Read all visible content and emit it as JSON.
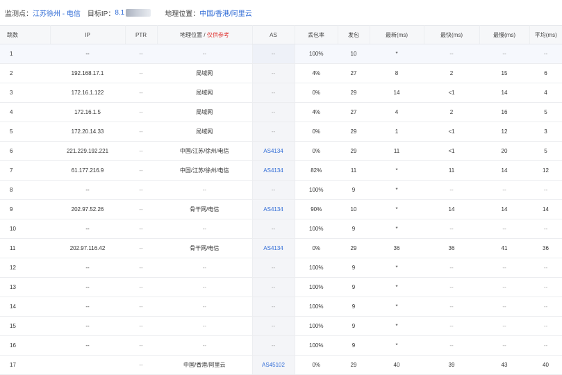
{
  "header": {
    "monitor_label": "监测点：",
    "monitor_value": "江苏徐州 - 电信",
    "target_label": "目标IP：",
    "target_value": "8.1",
    "geo_label": "地理位置：",
    "geo_value": "中国/香港/阿里云"
  },
  "columns": {
    "hop": "跳数",
    "ip": "IP",
    "ptr": "PTR",
    "geo": "地理位置 / ",
    "geo_note": "仅供参考",
    "as": "AS",
    "loss": "丢包率",
    "sent": "发包",
    "last": "最新(ms)",
    "best": "最快(ms)",
    "worst": "最慢(ms)",
    "avg": "平均(ms)"
  },
  "colors": {
    "link": "#2f6bd6",
    "note_red": "#e0312e",
    "header_bg": "#f6f7f9",
    "highlight_row": "#f6f8fd"
  },
  "rows": [
    {
      "hop": "1",
      "ip": "--",
      "ptr": "--",
      "geo": "--",
      "as": "--",
      "loss": "100%",
      "sent": "10",
      "last": "*",
      "best": "--",
      "worst": "--",
      "avg": "--"
    },
    {
      "hop": "2",
      "ip": "192.168.17.1",
      "ptr": "--",
      "geo": "局域网",
      "as": "--",
      "loss": "4%",
      "sent": "27",
      "last": "8",
      "best": "2",
      "worst": "15",
      "avg": "6"
    },
    {
      "hop": "3",
      "ip": "172.16.1.122",
      "ptr": "--",
      "geo": "局域网",
      "as": "--",
      "loss": "0%",
      "sent": "29",
      "last": "14",
      "best": "<1",
      "worst": "14",
      "avg": "4"
    },
    {
      "hop": "4",
      "ip": "172.16.1.5",
      "ptr": "--",
      "geo": "局域网",
      "as": "--",
      "loss": "4%",
      "sent": "27",
      "last": "4",
      "best": "2",
      "worst": "16",
      "avg": "5"
    },
    {
      "hop": "5",
      "ip": "172.20.14.33",
      "ptr": "--",
      "geo": "局域网",
      "as": "--",
      "loss": "0%",
      "sent": "29",
      "last": "1",
      "best": "<1",
      "worst": "12",
      "avg": "3"
    },
    {
      "hop": "6",
      "ip": "221.229.192.221",
      "ptr": "--",
      "geo": "中国/江苏/徐州/电信",
      "as": "AS4134",
      "loss": "0%",
      "sent": "29",
      "last": "11",
      "best": "<1",
      "worst": "20",
      "avg": "5"
    },
    {
      "hop": "7",
      "ip": "61.177.216.9",
      "ptr": "--",
      "geo": "中国/江苏/徐州/电信",
      "as": "AS4134",
      "loss": "82%",
      "sent": "11",
      "last": "*",
      "best": "11",
      "worst": "14",
      "avg": "12"
    },
    {
      "hop": "8",
      "ip": "--",
      "ptr": "--",
      "geo": "--",
      "as": "--",
      "loss": "100%",
      "sent": "9",
      "last": "*",
      "best": "--",
      "worst": "--",
      "avg": "--"
    },
    {
      "hop": "9",
      "ip": "202.97.52.26",
      "ptr": "--",
      "geo": "骨干网/电信",
      "as": "AS4134",
      "loss": "90%",
      "sent": "10",
      "last": "*",
      "best": "14",
      "worst": "14",
      "avg": "14"
    },
    {
      "hop": "10",
      "ip": "--",
      "ptr": "--",
      "geo": "--",
      "as": "--",
      "loss": "100%",
      "sent": "9",
      "last": "*",
      "best": "--",
      "worst": "--",
      "avg": "--"
    },
    {
      "hop": "11",
      "ip": "202.97.116.42",
      "ptr": "--",
      "geo": "骨干网/电信",
      "as": "AS4134",
      "loss": "0%",
      "sent": "29",
      "last": "36",
      "best": "36",
      "worst": "41",
      "avg": "36"
    },
    {
      "hop": "12",
      "ip": "--",
      "ptr": "--",
      "geo": "--",
      "as": "--",
      "loss": "100%",
      "sent": "9",
      "last": "*",
      "best": "--",
      "worst": "--",
      "avg": "--"
    },
    {
      "hop": "13",
      "ip": "--",
      "ptr": "--",
      "geo": "--",
      "as": "--",
      "loss": "100%",
      "sent": "9",
      "last": "*",
      "best": "--",
      "worst": "--",
      "avg": "--"
    },
    {
      "hop": "14",
      "ip": "--",
      "ptr": "--",
      "geo": "--",
      "as": "--",
      "loss": "100%",
      "sent": "9",
      "last": "*",
      "best": "--",
      "worst": "--",
      "avg": "--"
    },
    {
      "hop": "15",
      "ip": "--",
      "ptr": "--",
      "geo": "--",
      "as": "--",
      "loss": "100%",
      "sent": "9",
      "last": "*",
      "best": "--",
      "worst": "--",
      "avg": "--"
    },
    {
      "hop": "16",
      "ip": "--",
      "ptr": "--",
      "geo": "--",
      "as": "--",
      "loss": "100%",
      "sent": "9",
      "last": "*",
      "best": "--",
      "worst": "--",
      "avg": "--"
    },
    {
      "hop": "17",
      "ip": "",
      "ptr": "--",
      "geo": "中国/香港/阿里云",
      "as": "AS45102",
      "loss": "0%",
      "sent": "29",
      "last": "40",
      "best": "39",
      "worst": "43",
      "avg": "40"
    }
  ]
}
